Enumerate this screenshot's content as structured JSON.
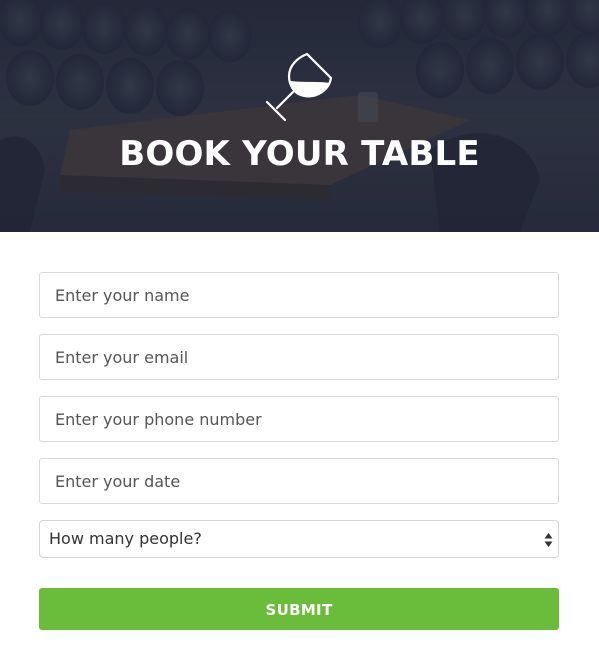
{
  "hero": {
    "title": "BOOK YOUR TABLE",
    "icon": "wine-glass-icon",
    "overlay_color": "#2c3244"
  },
  "form": {
    "name_placeholder": "Enter your name",
    "email_placeholder": "Enter your email",
    "phone_placeholder": "Enter your phone number",
    "date_placeholder": "Enter your date",
    "people_select": {
      "selected": "How many people?",
      "icon": "select-arrows-icon"
    },
    "submit_label": "SUBMIT"
  },
  "colors": {
    "accent": "#6abd3a",
    "field_border": "#d9d9d9",
    "hero_title": "#ffffff"
  }
}
